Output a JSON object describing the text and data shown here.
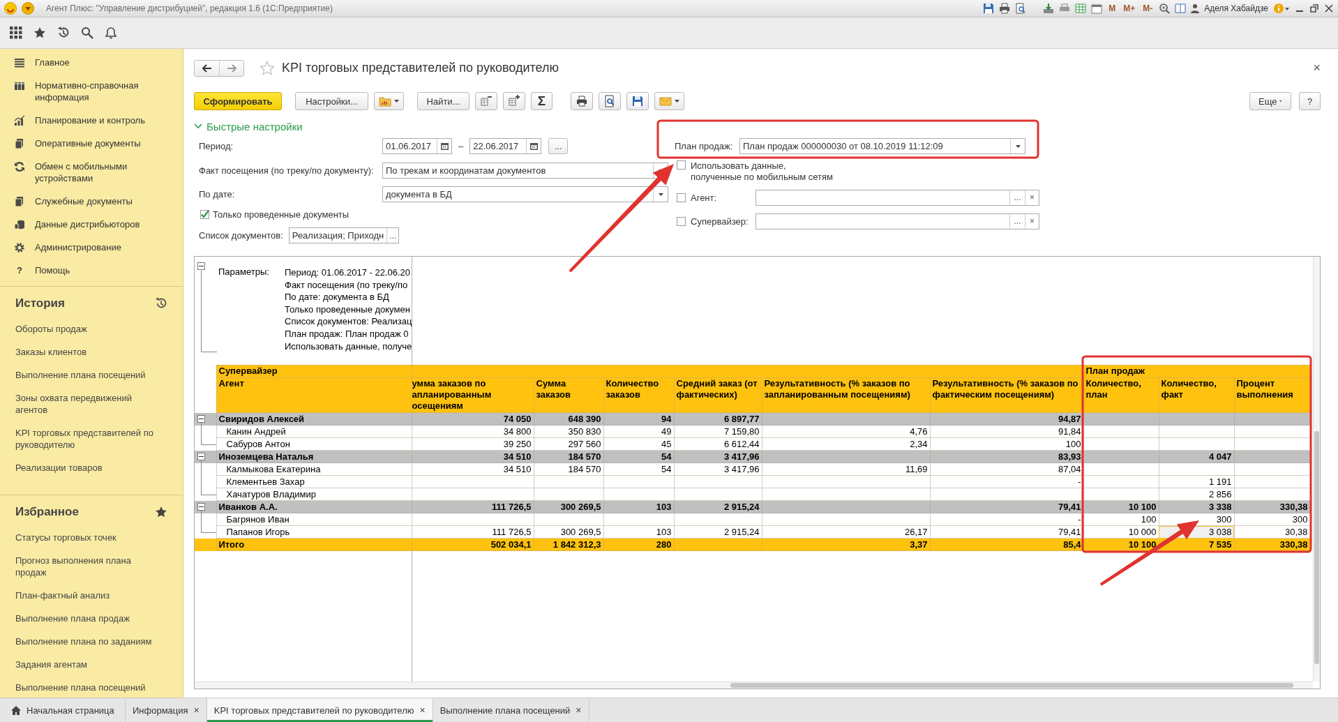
{
  "titlebar": {
    "title": "Агент Плюс: \"Управление дистрибуцией\", редакция 1.6  (1С:Предприятие)",
    "memory_buttons": [
      "M",
      "M+",
      "M-"
    ],
    "user": "Аделя Хабайдзе"
  },
  "sidebar": {
    "nav": [
      {
        "label": "Главное"
      },
      {
        "label": "Нормативно-справочная информация"
      },
      {
        "label": "Планирование и контроль"
      },
      {
        "label": "Оперативные документы"
      },
      {
        "label": "Обмен с мобильными устройствами"
      },
      {
        "label": "Служебные документы"
      },
      {
        "label": "Данные дистрибьюторов"
      },
      {
        "label": "Администрирование"
      },
      {
        "label": "Помощь",
        "glyph": "?"
      }
    ],
    "history": {
      "title": "История",
      "items": [
        "Обороты продаж",
        "Заказы клиентов",
        "Выполнение плана посещений",
        "Зоны охвата передвижений агентов",
        "KPI торговых представителей по руководителю",
        "Реализации товаров"
      ]
    },
    "favorites": {
      "title": "Избранное",
      "items": [
        "Статусы торговых точек",
        "Прогноз выполнения плана продаж",
        "План-фактный анализ",
        "Выполнение плана продаж",
        "Выполнение плана по заданиям",
        "Задания агентам",
        "Выполнение плана посещений"
      ]
    }
  },
  "form": {
    "title": "KPI торговых представителей по руководителю",
    "favorite": false,
    "close": "×",
    "toolbar": {
      "generate": "Сформировать",
      "settings": "Настройки...",
      "find": "Найти...",
      "sum": "Σ",
      "more": "Еще",
      "help": "?"
    }
  },
  "quick_settings": {
    "title": "Быстрые настройки",
    "expanded": true,
    "period": {
      "label": "Период:",
      "from": "01.06.2017",
      "dash": "–",
      "to": "22.06.2017",
      "more": "..."
    },
    "visit_fact": {
      "label": "Факт посещения (по треку/по документу):",
      "value": "По трекам и координатам документов"
    },
    "by_date": {
      "label": "По дате:",
      "value": "документа в БД"
    },
    "posted_only": {
      "label": "Только проведенные документы",
      "checked": true
    },
    "documents": {
      "label": "Список документов:",
      "value": "Реализация; Приходн",
      "more": "..."
    },
    "sales_plan": {
      "label": "План продаж:",
      "value": "План продаж 000000030 от 08.10.2019 11:12:09"
    },
    "mobile_data": {
      "label": "Использовать данные,\nполученные по мобильным сетям",
      "checked": false
    },
    "agent": {
      "label": "Агент:",
      "checked": false,
      "more": "...",
      "clear": "×"
    },
    "supervisor": {
      "label": "Супервайзер:",
      "checked": false,
      "more": "...",
      "clear": "×"
    }
  },
  "report": {
    "parameters_expanded": true,
    "parameters_label": "Параметры:",
    "parameters": [
      "Период: 01.06.2017 - 22.06.20",
      "Факт посещения (по треку/по",
      "По дате: документа в БД",
      "Только проведенные докумен",
      "Список документов: Реализац",
      "План продаж: План продаж 0",
      "Использовать данные, получе"
    ],
    "group_header": "Супервайзер",
    "plan_group": "План продаж",
    "columns": [
      {
        "title": "Агент",
        "current": false
      },
      {
        "title": "умма заказов по апланированным осещениям",
        "current": false
      },
      {
        "title": "Сумма заказов",
        "current": false
      },
      {
        "title": "Количество заказов",
        "current": false
      },
      {
        "title": "Средний заказ (от фактических)",
        "current": false
      },
      {
        "title": "Результативность (% заказов по запланированным посещениям)",
        "current": false
      },
      {
        "title": "Результативность (% заказов по фактическим посещениям)",
        "current": false
      },
      {
        "title": "Количество, план",
        "current": false
      },
      {
        "title": "Количество, факт",
        "current": true
      },
      {
        "title": "Процент выполнения",
        "current": false
      }
    ],
    "rows": [
      {
        "kind": "group",
        "expanded": true,
        "selected": false,
        "cells": [
          "Свиридов Алексей",
          "74 050",
          "648 390",
          "94",
          "6 897,77",
          null,
          "94,87",
          null,
          null,
          null
        ]
      },
      {
        "kind": "item",
        "selected": false,
        "cells": [
          "Канин Андрей",
          "34 800",
          "350 830",
          "49",
          "7 159,80",
          "4,76",
          "91,84",
          null,
          null,
          null
        ]
      },
      {
        "kind": "item",
        "selected": false,
        "cells": [
          "Сабуров Антон",
          "39 250",
          "297 560",
          "45",
          "6 612,44",
          "2,34",
          "100",
          null,
          null,
          null
        ]
      },
      {
        "kind": "group",
        "expanded": true,
        "selected": false,
        "cells": [
          "Иноземцева Наталья",
          "34 510",
          "184 570",
          "54",
          "3 417,96",
          null,
          "83,93",
          null,
          "4 047",
          null
        ]
      },
      {
        "kind": "item",
        "selected": false,
        "cells": [
          "Калмыкова Екатерина",
          "34 510",
          "184 570",
          "54",
          "3 417,96",
          "11,69",
          "87,04",
          null,
          null,
          null
        ]
      },
      {
        "kind": "item",
        "selected": false,
        "cells": [
          "Клементьев Захар",
          null,
          null,
          null,
          null,
          null,
          "-",
          null,
          "1 191",
          null
        ]
      },
      {
        "kind": "item",
        "selected": false,
        "cells": [
          "Хачатуров Владимир",
          null,
          null,
          null,
          null,
          null,
          null,
          null,
          "2 856",
          null
        ]
      },
      {
        "kind": "group",
        "expanded": true,
        "selected": false,
        "cells": [
          "Иванков А.А.",
          "111 726,5",
          "300 269,5",
          "103",
          "2 915,24",
          null,
          "79,41",
          "10 100",
          "3 338",
          "330,38"
        ]
      },
      {
        "kind": "item",
        "selected": false,
        "cells": [
          "Багрянов Иван",
          null,
          null,
          null,
          null,
          null,
          "-",
          "100",
          "300",
          "300"
        ]
      },
      {
        "kind": "item",
        "selected": true,
        "cells": [
          "Папанов Игорь",
          "111 726,5",
          "300 269,5",
          "103",
          "2 915,24",
          "26,17",
          "79,41",
          "10 000",
          "3 038",
          "30,38"
        ]
      },
      {
        "kind": "total",
        "selected": false,
        "cells": [
          "Итого",
          "502 034,1",
          "1 842 312,3",
          "280",
          null,
          "3,37",
          "85,4",
          "10 100",
          "7 535",
          "330,38"
        ]
      }
    ]
  },
  "tabs": [
    {
      "label": "Начальная страница",
      "kind": "home",
      "selected": false
    },
    {
      "label": "Информация",
      "kind": "closable",
      "selected": false,
      "close": "×"
    },
    {
      "label": "KPI торговых представителей по руководителю",
      "kind": "closable",
      "selected": true,
      "close": "×"
    },
    {
      "label": "Выполнение плана посещений",
      "kind": "closable",
      "selected": false,
      "close": "×"
    }
  ]
}
